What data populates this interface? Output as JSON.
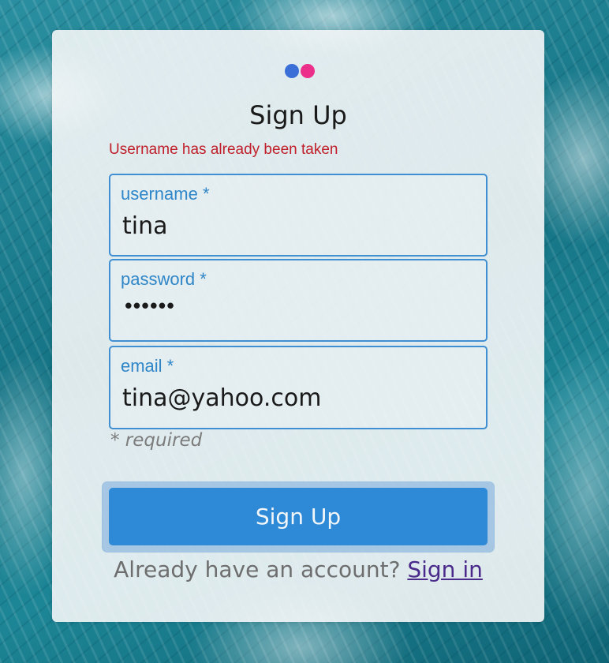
{
  "colors": {
    "logo_blue": "#3a6fd8",
    "logo_pink": "#ec2f8b",
    "error": "#c01f2a",
    "field_label": "#2f86c8",
    "accent": "#2e8ad6",
    "link": "#4a2a8a"
  },
  "form": {
    "title": "Sign Up",
    "error_message": "Username has already been taken",
    "fields": [
      {
        "label": "username *",
        "value": "tina",
        "type": "text"
      },
      {
        "label": "password *",
        "value": "••••••",
        "type": "password"
      },
      {
        "label": "email *",
        "value": "tina@yahoo.com",
        "type": "email"
      }
    ],
    "required_note": "* required",
    "submit_label": "Sign Up",
    "signin_prompt": "Already have an account?",
    "signin_link": "Sign in"
  }
}
